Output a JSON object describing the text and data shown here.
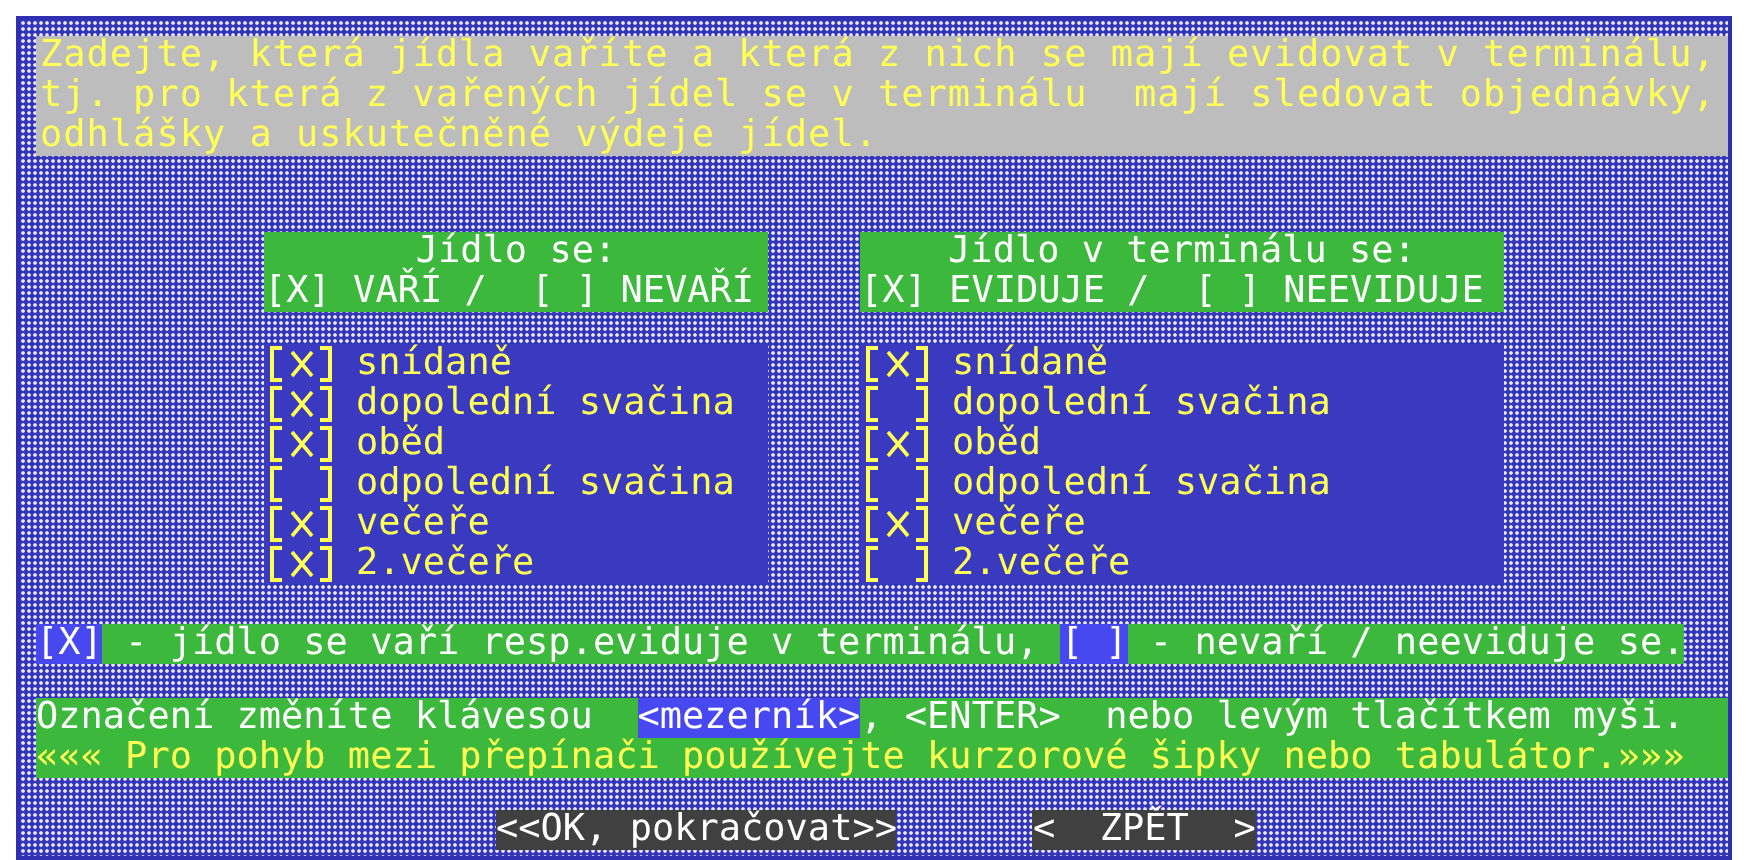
{
  "intro": "Zadejte, která jídla vaříte a která z nich se mají evidovat v terminálu,\ntj. pro která z vařených jídel se v terminálu  mají sledovat objednávky,\nodhlášky a uskutečněné výdeje jídel.",
  "columns": [
    {
      "title": "Jídlo se:",
      "legend": "[X] VAŘÍ /  [ ] NEVAŘÍ",
      "items": [
        {
          "label": "snídaně",
          "checked": true
        },
        {
          "label": "dopolední svačina",
          "checked": true
        },
        {
          "label": "oběd",
          "checked": true
        },
        {
          "label": "odpolední svačina",
          "checked": false
        },
        {
          "label": "večeře",
          "checked": true
        },
        {
          "label": "2.večeře",
          "checked": true
        }
      ]
    },
    {
      "title": "Jídlo v terminálu se:",
      "legend": "[X] EVIDUJE /  [ ] NEEVIDUJE",
      "items": [
        {
          "label": "snídaně",
          "checked": true
        },
        {
          "label": "dopolední svačina",
          "checked": false
        },
        {
          "label": "oběd",
          "checked": true
        },
        {
          "label": "odpolední svačina",
          "checked": false
        },
        {
          "label": "večeře",
          "checked": true
        },
        {
          "label": "2.večeře",
          "checked": false
        }
      ]
    }
  ],
  "legend": [
    {
      "mark": "[X]",
      "text": " - jídlo se vaří resp.eviduje v terminálu, "
    },
    {
      "mark": "[ ]",
      "text": " - nevaří / neeviduje se."
    }
  ],
  "help": {
    "before": "Označení změníte klávesou  ",
    "key": "<mezerník>",
    "after": ", <ENTER>  nebo levým tlačítkem myši.",
    "hint": "««« Pro pohyb mezi přepínači používejte kurzorové šipky nebo tabulátor.»»»"
  },
  "buttons": [
    "<<OK, pokračovat>>",
    "<  ZPĚT  >"
  ]
}
